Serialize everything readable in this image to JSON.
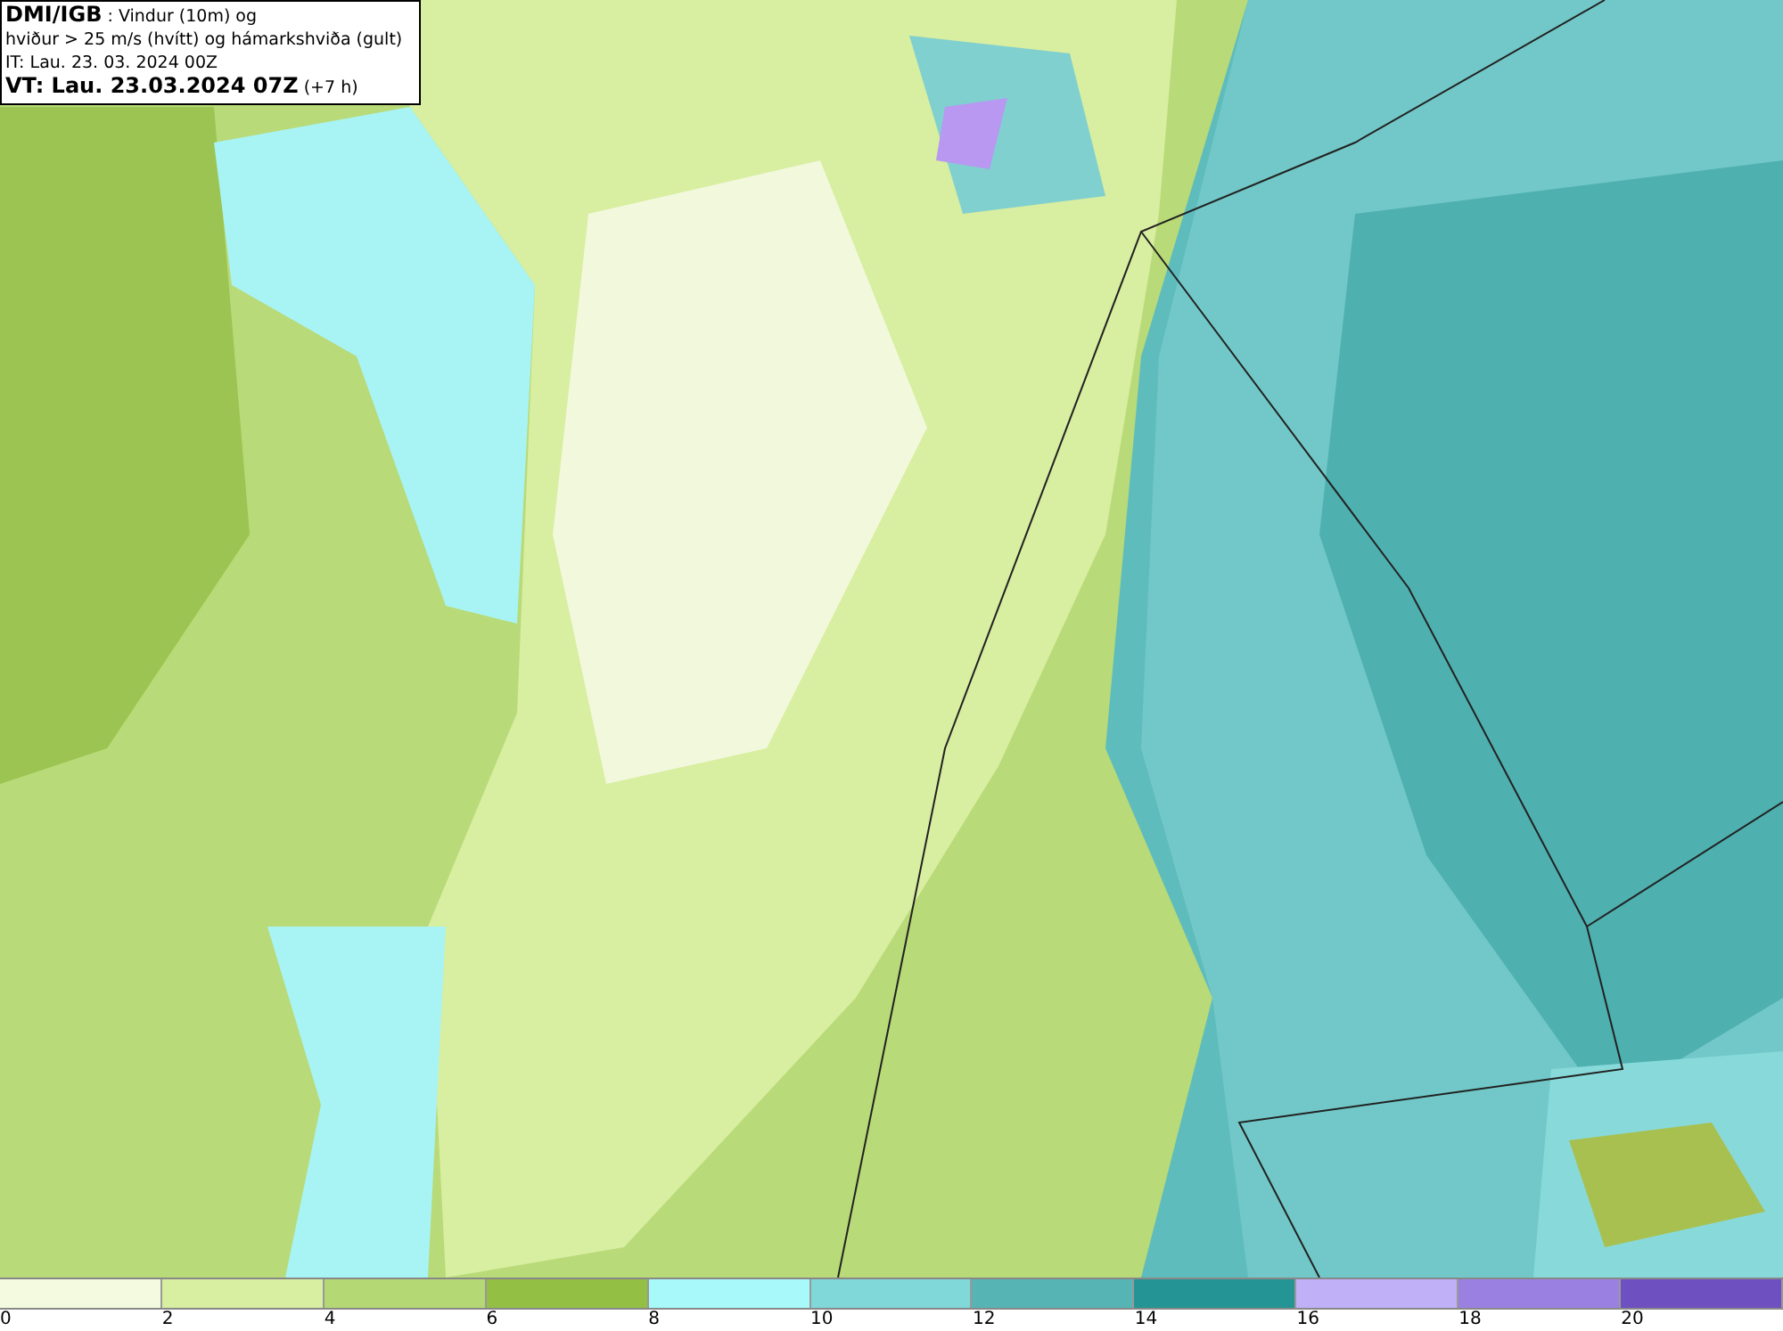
{
  "header": {
    "source": "DMI/IGB",
    "title_line_1": ": Vindur (10m) og",
    "title_line_2": "hviður > 25 m/s (hvítt) og hámarkshviða (gult)",
    "initial_time": "IT: Lau. 23. 03. 2024 00Z",
    "valid_time": "VT: Lau. 23.03.2024 07Z",
    "lead_time": "(+7 h)"
  },
  "legend": {
    "bins": [
      {
        "color": "#f4fae0"
      },
      {
        "color": "#d8eea0"
      },
      {
        "color": "#b4d873"
      },
      {
        "color": "#94bf45"
      },
      {
        "color": "#a8fafa"
      },
      {
        "color": "#80d8d8"
      },
      {
        "color": "#56b4b4"
      },
      {
        "color": "#259494"
      },
      {
        "color": "#c0b0f8"
      },
      {
        "color": "#9a80e0"
      },
      {
        "color": "#6e50c0"
      }
    ],
    "ticks": [
      "0",
      "2",
      "4",
      "6",
      "8",
      "10",
      "12",
      "14",
      "16",
      "18",
      "20"
    ]
  }
}
